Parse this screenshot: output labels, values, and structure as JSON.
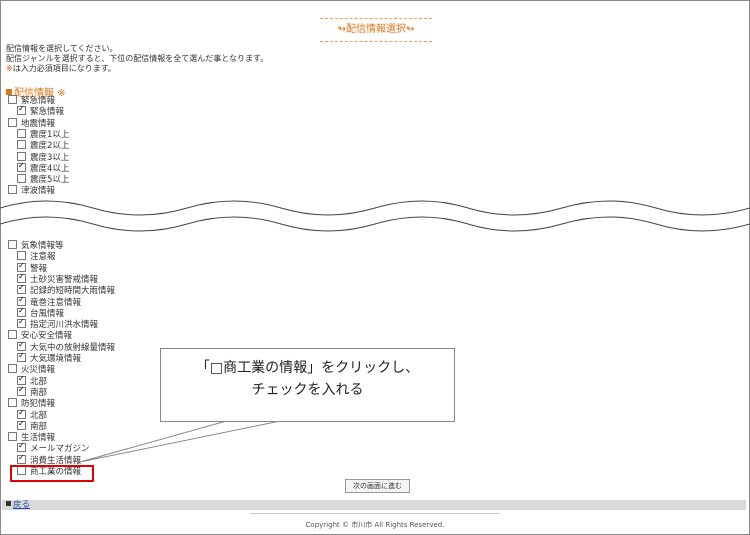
{
  "page": {
    "title": "配信情報選択",
    "intro_line1": "配信情報を選択してください。",
    "intro_line2": "配信ジャンルを選択すると、下位の配信情報を全て選んだ事となります。",
    "intro_req_mark": "※",
    "intro_line3_rest": "は入力必須項目になります。",
    "section_title": "配信情報",
    "section_req": "※"
  },
  "items_top": [
    {
      "label": "緊急情報",
      "checked": false,
      "level": 0
    },
    {
      "label": "緊急情報",
      "checked": true,
      "level": 1
    },
    {
      "label": "地震情報",
      "checked": false,
      "level": 0
    },
    {
      "label": "震度1以上",
      "checked": false,
      "level": 1
    },
    {
      "label": "震度2以上",
      "checked": false,
      "level": 1
    },
    {
      "label": "震度3以上",
      "checked": false,
      "level": 1
    },
    {
      "label": "震度4以上",
      "checked": true,
      "level": 1
    },
    {
      "label": "震度5以上",
      "checked": false,
      "level": 1
    },
    {
      "label": "津波情報",
      "checked": false,
      "level": 0
    }
  ],
  "items_bottom": [
    {
      "label": "気象情報等",
      "checked": false,
      "level": 0
    },
    {
      "label": "注意報",
      "checked": false,
      "level": 1
    },
    {
      "label": "警報",
      "checked": true,
      "level": 1
    },
    {
      "label": "土砂災害警戒情報",
      "checked": true,
      "level": 1
    },
    {
      "label": "記録的短時間大雨情報",
      "checked": true,
      "level": 1
    },
    {
      "label": "竜巻注意情報",
      "checked": true,
      "level": 1
    },
    {
      "label": "台風情報",
      "checked": true,
      "level": 1
    },
    {
      "label": "指定河川洪水情報",
      "checked": true,
      "level": 1
    },
    {
      "label": "安心安全情報",
      "checked": false,
      "level": 0
    },
    {
      "label": "大気中の放射線量情報",
      "checked": true,
      "level": 1
    },
    {
      "label": "大気環境情報",
      "checked": true,
      "level": 1
    },
    {
      "label": "火災情報",
      "checked": false,
      "level": 0
    },
    {
      "label": "北部",
      "checked": true,
      "level": 1
    },
    {
      "label": "南部",
      "checked": true,
      "level": 1
    },
    {
      "label": "防犯情報",
      "checked": false,
      "level": 0
    },
    {
      "label": "北部",
      "checked": true,
      "level": 1
    },
    {
      "label": "南部",
      "checked": true,
      "level": 1
    },
    {
      "label": "生活情報",
      "checked": false,
      "level": 0
    },
    {
      "label": "メールマガジン",
      "checked": true,
      "level": 1
    },
    {
      "label": "消費生活情報",
      "checked": true,
      "level": 1
    },
    {
      "label": "商工業の情報",
      "checked": false,
      "level": 1
    }
  ],
  "callout": {
    "line1": "「□商工業の情報」をクリックし、",
    "line2": "チェックを入れる"
  },
  "buttons": {
    "next": "次の画面に進む",
    "back": "戻る"
  },
  "footer": {
    "copyright": "Copyright © 市川市 All Rights Reserved."
  },
  "colors": {
    "accent": "#e0741a",
    "highlight": "#e00000",
    "link": "#1a4ab0"
  }
}
